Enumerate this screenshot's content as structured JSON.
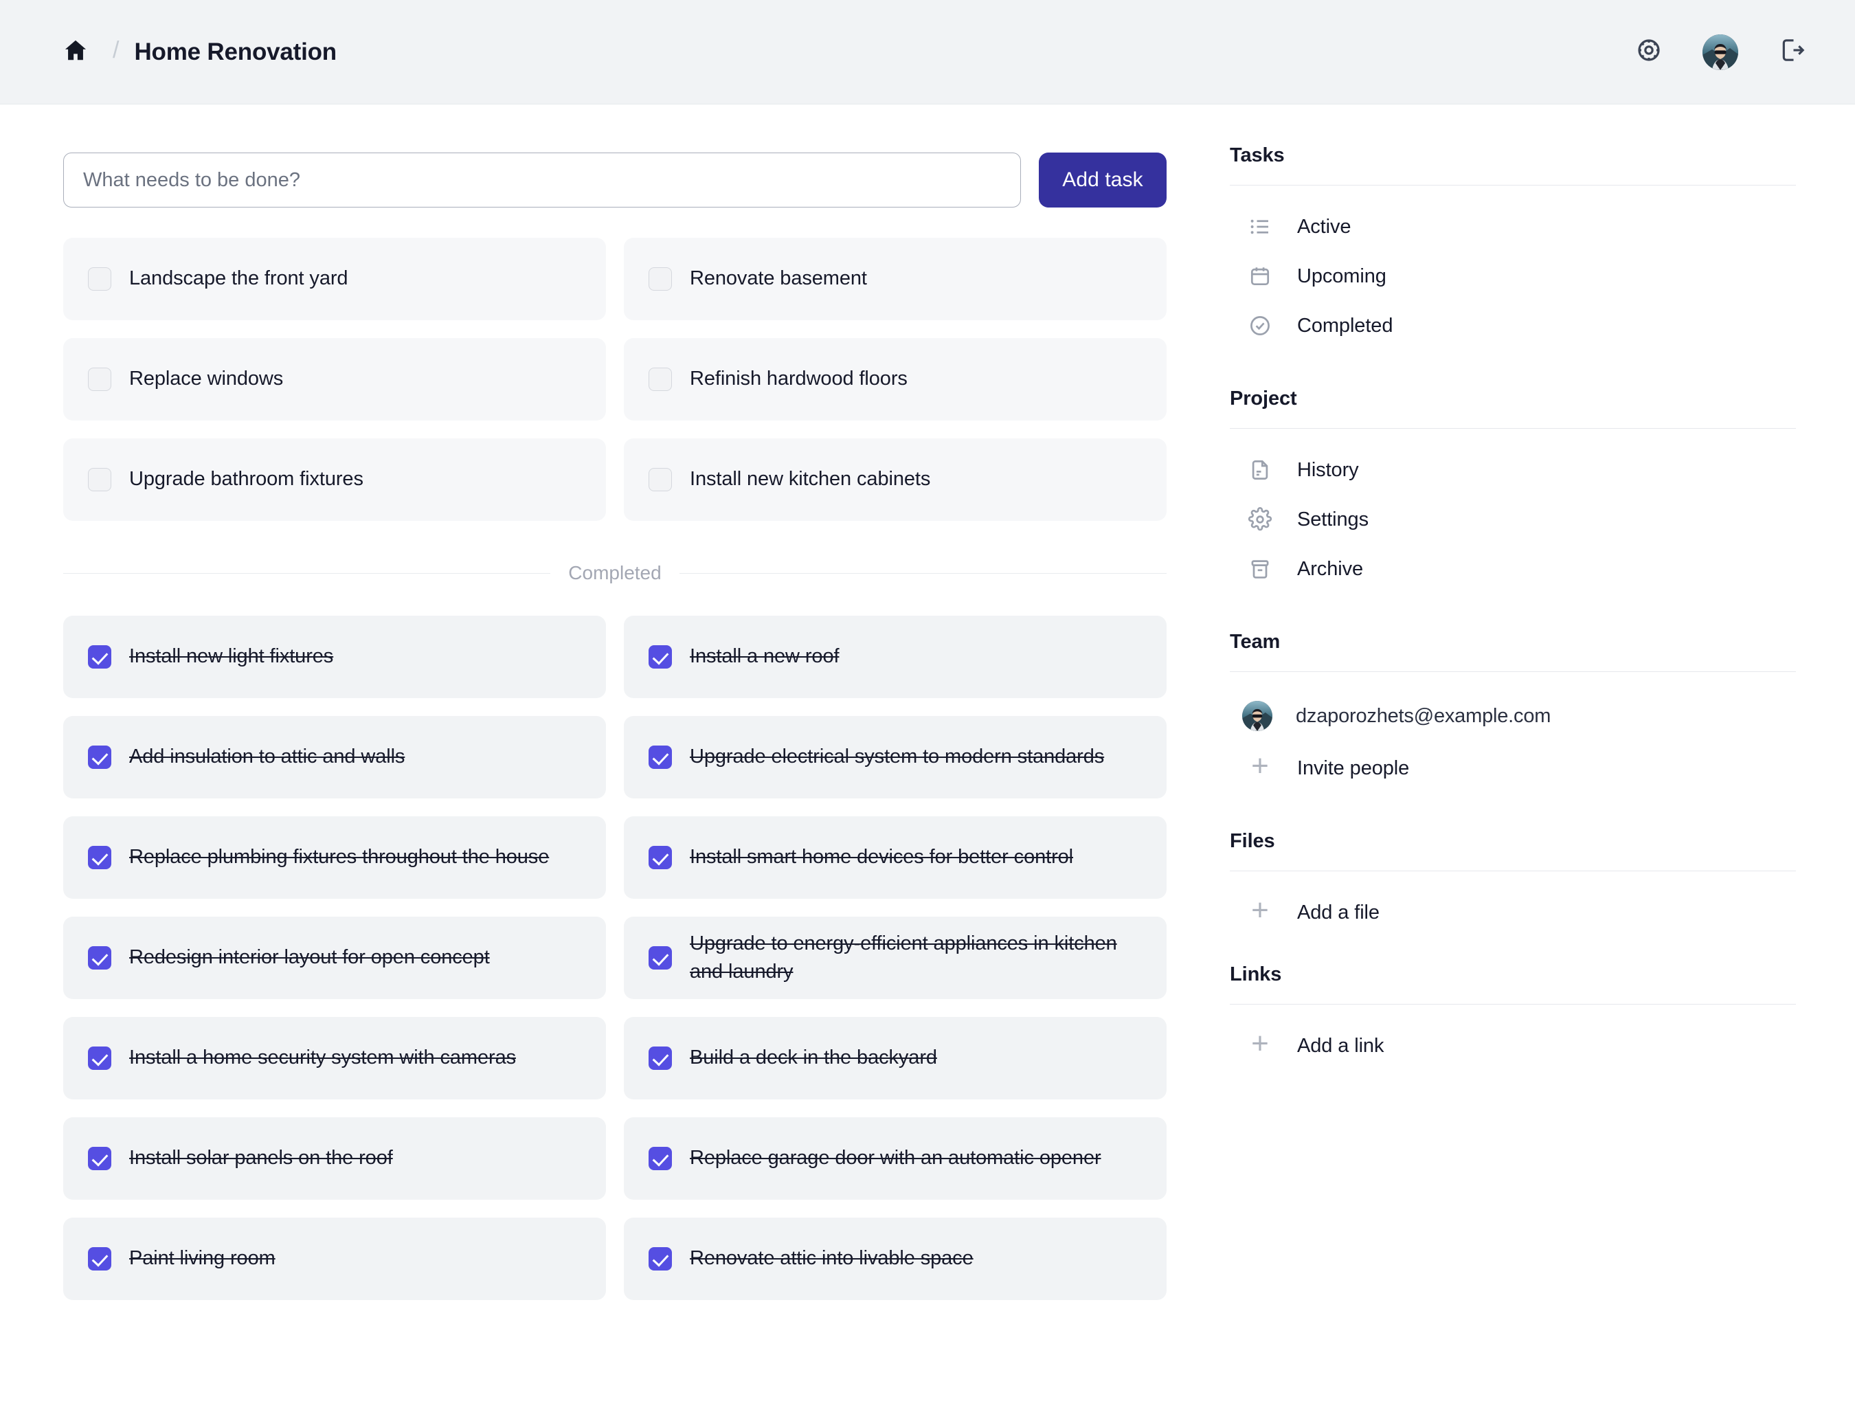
{
  "header": {
    "home_icon": "home-icon",
    "separator": "/",
    "title": "Home Renovation",
    "settings_icon": "gear-icon",
    "avatar_icon": "user-avatar",
    "logout_icon": "logout-icon"
  },
  "composer": {
    "placeholder": "What needs to be done?",
    "value": "",
    "add_label": "Add task"
  },
  "divider": {
    "label": "Completed"
  },
  "active_tasks": [
    {
      "label": "Landscape the front yard",
      "checked": false
    },
    {
      "label": "Renovate basement",
      "checked": false
    },
    {
      "label": "Replace windows",
      "checked": false
    },
    {
      "label": "Refinish hardwood floors",
      "checked": false
    },
    {
      "label": "Upgrade bathroom fixtures",
      "checked": false
    },
    {
      "label": "Install new kitchen cabinets",
      "checked": false
    }
  ],
  "completed_tasks": [
    {
      "label": "Install new light fixtures",
      "checked": true
    },
    {
      "label": "Install a new roof",
      "checked": true
    },
    {
      "label": "Add insulation to attic and walls",
      "checked": true
    },
    {
      "label": "Upgrade electrical system to modern standards",
      "checked": true
    },
    {
      "label": "Replace plumbing fixtures throughout the house",
      "checked": true
    },
    {
      "label": "Install smart home devices for better control",
      "checked": true
    },
    {
      "label": "Redesign interior layout for open concept",
      "checked": true
    },
    {
      "label": "Upgrade to energy-efficient appliances in kitchen and laundry",
      "checked": true
    },
    {
      "label": "Install a home security system with cameras",
      "checked": true
    },
    {
      "label": "Build a deck in the backyard",
      "checked": true
    },
    {
      "label": "Install solar panels on the roof",
      "checked": true
    },
    {
      "label": "Replace garage door with an automatic opener",
      "checked": true
    },
    {
      "label": "Paint living room",
      "checked": true
    },
    {
      "label": "Renovate attic into livable space",
      "checked": true
    }
  ],
  "sidebar": {
    "tasks": {
      "title": "Tasks",
      "items": [
        {
          "label": "Active",
          "icon": "list-icon"
        },
        {
          "label": "Upcoming",
          "icon": "calendar-icon"
        },
        {
          "label": "Completed",
          "icon": "check-circle-icon"
        }
      ]
    },
    "project": {
      "title": "Project",
      "items": [
        {
          "label": "History",
          "icon": "document-icon"
        },
        {
          "label": "Settings",
          "icon": "gear-icon"
        },
        {
          "label": "Archive",
          "icon": "archive-icon"
        }
      ]
    },
    "team": {
      "title": "Team",
      "member_email": "dzaporozhets@example.com",
      "invite_label": "Invite people",
      "invite_icon": "plus-icon"
    },
    "files": {
      "title": "Files",
      "add_label": "Add a file",
      "add_icon": "plus-icon"
    },
    "links": {
      "title": "Links",
      "add_label": "Add a link",
      "add_icon": "plus-icon"
    }
  },
  "colors": {
    "accent": "#35319E",
    "checkbox": "#554EE2",
    "header_bg": "#F1F3F5",
    "card_bg": "#F6F7F9",
    "card_done_bg": "#F1F3F5",
    "text": "#16192A",
    "muted": "#A3A7B3"
  }
}
